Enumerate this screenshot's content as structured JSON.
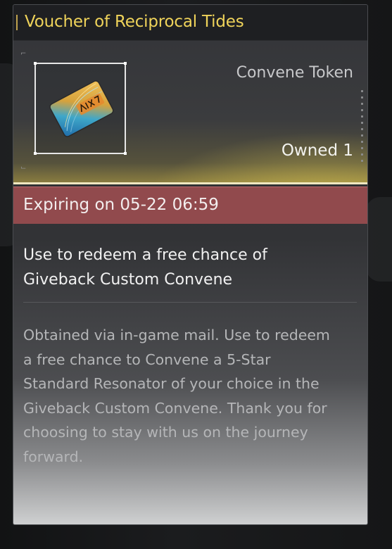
{
  "item": {
    "name": "Voucher of Reciprocal Tides",
    "type": "Convene Token",
    "owned": "Owned 1",
    "expiry": "Expiring on 05-22 06:59",
    "summary_lines": [
      "Use to redeem a free chance of",
      "Giveback Custom Convene"
    ],
    "description_lines": [
      "Obtained via in-game mail. Use to redeem",
      "a free chance to Convene a 5-Star",
      "Standard Resonator of your choice in the",
      "Giveback Custom Convene. Thank you for",
      "choosing to stay with us on the journey",
      "forward."
    ],
    "icon": "voucher-card-icon"
  },
  "colors": {
    "title": "#efd35a",
    "expiry_band": "#914a4d",
    "panel_bg": "#2b2c2f",
    "header_glow": "#d2be50"
  }
}
